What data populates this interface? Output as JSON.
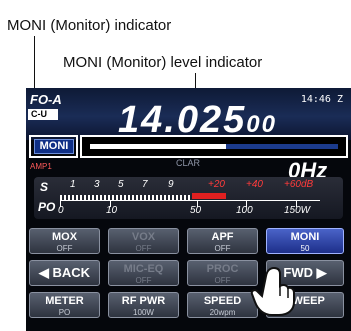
{
  "callouts": {
    "moni_indicator": "MONI (Monitor) indicator",
    "moni_level_indicator": "MONI (Monitor) level indicator"
  },
  "display": {
    "vfo": "FO-A",
    "mode": "C-U",
    "clock": "14:46",
    "clock_suffix": "Z",
    "frequency_main": "14.025",
    "frequency_small": "00",
    "freq_unit": "0Hz",
    "amp": "AMP1",
    "mid_text": "CLAR",
    "moni_indicator_label": "MONI",
    "moni_level_fraction": 0.55
  },
  "meter": {
    "s_label": "S",
    "po_label": "PO",
    "s_scale": [
      "1",
      "3",
      "5",
      "7",
      "9",
      "+20",
      "+40",
      "+60dB"
    ],
    "po_scale": [
      "0",
      "10",
      "50",
      "100",
      "150W"
    ]
  },
  "buttons": [
    {
      "label": "MOX",
      "value": "OFF",
      "state": "normal"
    },
    {
      "label": "VOX",
      "value": "OFF",
      "state": "dim"
    },
    {
      "label": "APF",
      "value": "OFF",
      "state": "normal"
    },
    {
      "label": "MONI",
      "value": "50",
      "state": "on"
    },
    {
      "label": "BACK",
      "value": "",
      "state": "arrow-left"
    },
    {
      "label": "MIC-EQ",
      "value": "OFF",
      "state": "dim"
    },
    {
      "label": "PROC",
      "value": "OFF",
      "state": "dim"
    },
    {
      "label": "FWD",
      "value": "",
      "state": "arrow-right"
    },
    {
      "label": "METER",
      "value": "PO",
      "state": "normal"
    },
    {
      "label": "RF PWR",
      "value": "100W",
      "state": "normal"
    },
    {
      "label": "SPEED",
      "value": "20wpm",
      "state": "normal"
    },
    {
      "label": "SWEEP",
      "value": "",
      "state": "normal"
    }
  ],
  "colors": {
    "screen_bg": "#05070c",
    "moni_active": "#1d2f8a",
    "peak_red": "#e02020"
  },
  "icons": {
    "hand": "pointing-hand-icon",
    "back": "back-arrow-icon",
    "fwd": "forward-arrow-icon"
  }
}
